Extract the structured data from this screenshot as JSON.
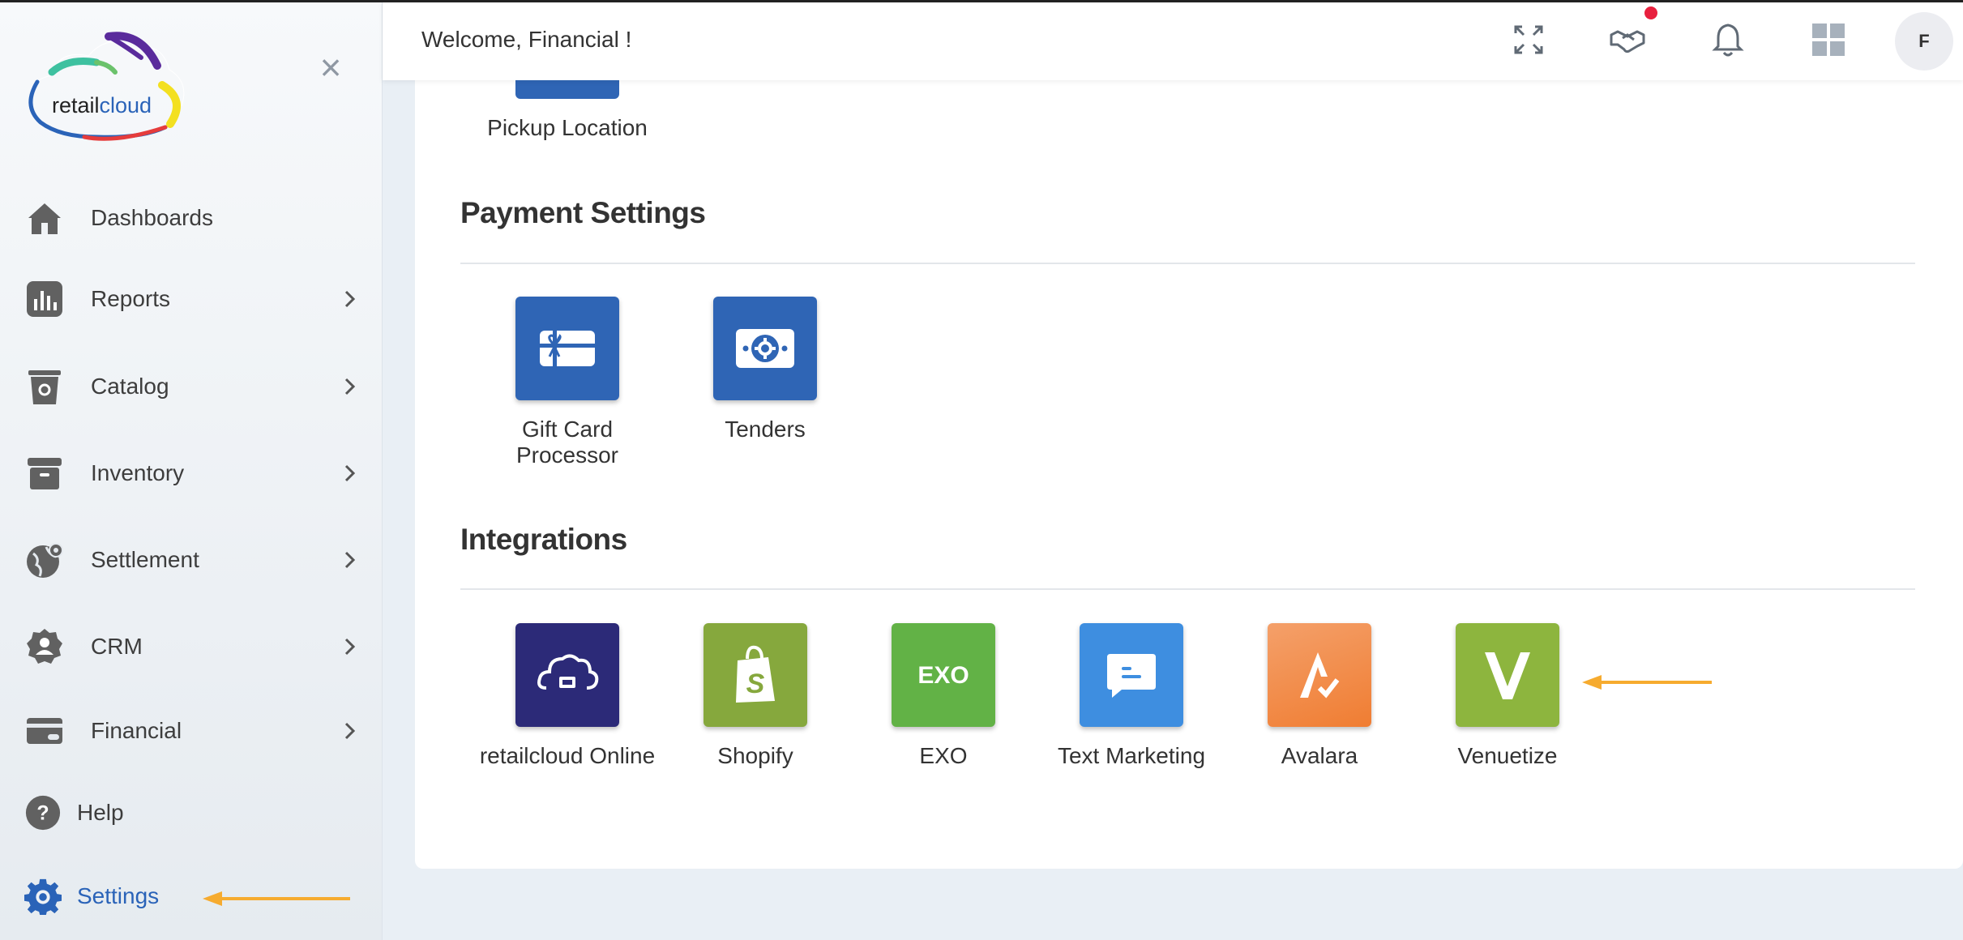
{
  "sidebar": {
    "logo_text_a": "retail",
    "logo_text_b": "cloud",
    "items": [
      {
        "label": "Dashboards"
      },
      {
        "label": "Reports"
      },
      {
        "label": "Catalog"
      },
      {
        "label": "Inventory"
      },
      {
        "label": "Settlement"
      },
      {
        "label": "CRM"
      },
      {
        "label": "Financial"
      },
      {
        "label": "Help"
      },
      {
        "label": "Settings"
      }
    ]
  },
  "header": {
    "welcome": "Welcome, Financial !",
    "avatar_initial": "F"
  },
  "content": {
    "partial_tile": {
      "label": "Pickup Location"
    },
    "payment": {
      "title": "Payment Settings",
      "tiles": [
        {
          "label": "Gift Card Processor",
          "icon": "gift-card-icon",
          "color": "#2f65b5"
        },
        {
          "label": "Tenders",
          "icon": "cash-icon",
          "color": "#2f65b5"
        }
      ]
    },
    "integrations": {
      "title": "Integrations",
      "tiles": [
        {
          "label": "retailcloud Online",
          "icon": "cloud-cart-icon",
          "color": "#2c2a78"
        },
        {
          "label": "Shopify",
          "icon": "shopify-bag-icon",
          "color": "#86a83d"
        },
        {
          "label": "EXO",
          "icon": "exo-logo-icon",
          "color": "#62b246"
        },
        {
          "label": "Text Marketing",
          "icon": "chat-bubble-icon",
          "color": "#3e8ee0"
        },
        {
          "label": "Avalara",
          "icon": "avalara-logo-icon",
          "color": "#f07d32"
        },
        {
          "label": "Venuetize",
          "icon": "venuetize-logo-icon",
          "color": "#8db53e"
        }
      ]
    }
  },
  "colors": {
    "accent": "#2a63b8",
    "annotation_arrow": "#f6ab2f",
    "notification_dot": "#e8203e"
  }
}
